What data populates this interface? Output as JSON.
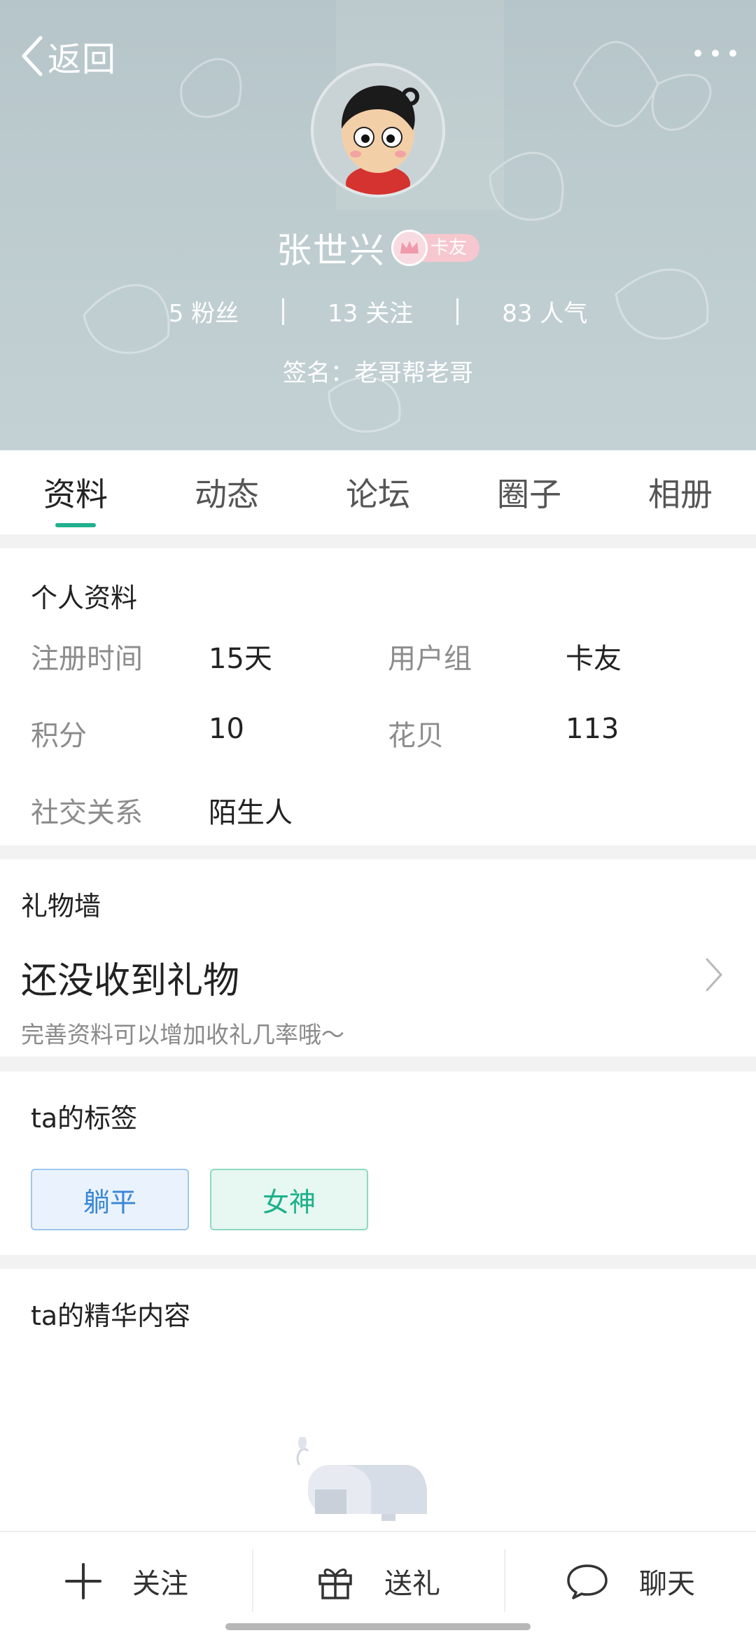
{
  "header": {
    "back_label": "返回",
    "name": "张世兴",
    "badge": "卡友",
    "stats": {
      "fans": "5 粉丝",
      "following": "13 关注",
      "popularity": "83 人气"
    },
    "signature": "签名：老哥帮老哥",
    "background_color": "#bccbce"
  },
  "tabs": [
    {
      "label": "资料",
      "active": true
    },
    {
      "label": "动态",
      "active": false
    },
    {
      "label": "论坛",
      "active": false
    },
    {
      "label": "圈子",
      "active": false
    },
    {
      "label": "相册",
      "active": false
    }
  ],
  "profile": {
    "title": "个人资料",
    "fields": {
      "register_time": {
        "label": "注册时间",
        "value": "15天"
      },
      "user_group": {
        "label": "用户组",
        "value": "卡友"
      },
      "points": {
        "label": "积分",
        "value": "10"
      },
      "flower_shells": {
        "label": "花贝",
        "value": "113"
      },
      "relation": {
        "label": "社交关系",
        "value": "陌生人"
      }
    }
  },
  "gift_wall": {
    "title": "礼物墙",
    "main": "还没收到礼物",
    "sub": "完善资料可以增加收礼几率哦～"
  },
  "tags": {
    "title": "ta的标签",
    "items": [
      "躺平",
      "女神"
    ]
  },
  "essence": {
    "title": "ta的精华内容"
  },
  "bottom_bar": {
    "follow": "关注",
    "gift": "送礼",
    "chat": "聊天"
  },
  "colors": {
    "accent": "#20b08e",
    "tag_blue": "#3a86d6",
    "tag_green": "#1bb18a"
  }
}
